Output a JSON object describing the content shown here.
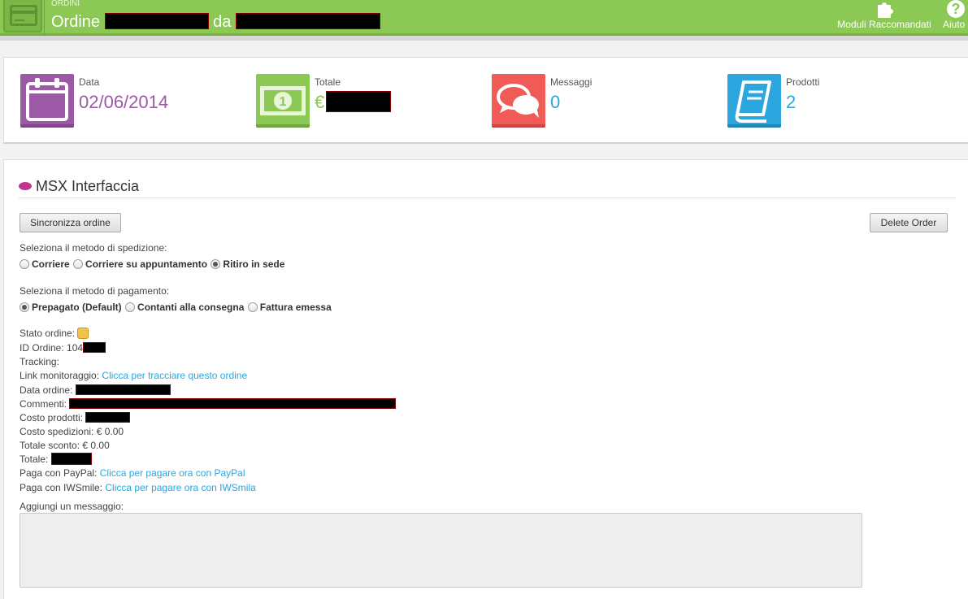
{
  "header": {
    "breadcrumb": "Ordini",
    "title_prefix": "Ordine",
    "title_connector": "da",
    "actions": [
      {
        "label": "Moduli Raccomandati",
        "icon": "puzzle-icon"
      },
      {
        "label": "Aiuto",
        "icon": "help-icon"
      }
    ],
    "colors": {
      "header_bg": "#8bc954",
      "header_border": "#76b03f"
    }
  },
  "kpis": {
    "data": {
      "label": "Data",
      "value": "02/06/2014",
      "icon": "calendar-icon",
      "color": "#9c5aa6"
    },
    "totale": {
      "label": "Totale",
      "currency": "€",
      "icon": "banknote-icon",
      "color": "#8bc954"
    },
    "messaggi": {
      "label": "Messaggi",
      "value": "0",
      "icon": "chat-bubbles-icon",
      "color": "#f05a57"
    },
    "prodotti": {
      "label": "Prodotti",
      "value": "2",
      "icon": "book-icon",
      "color": "#2ba6de"
    }
  },
  "module": {
    "title": "MSX Interfaccia",
    "sync_button": "Sincronizza ordine",
    "delete_button": "Delete Order",
    "shipping": {
      "label": "Seleziona il metodo di spedizione:",
      "options": [
        "Corriere",
        "Corriere su appuntamento",
        "Ritiro in sede"
      ],
      "selected": "Ritiro in sede"
    },
    "payment": {
      "label": "Seleziona il metodo di pagamento:",
      "options": [
        "Prepagato (Default)",
        "Contanti alla consegna",
        "Fattura emessa"
      ],
      "selected": "Prepagato (Default)"
    },
    "details": {
      "stato_label": "Stato ordine:",
      "id_label": "ID Ordine:",
      "id_prefix": "104",
      "tracking_label": "Tracking:",
      "link_label": "Link monitoraggio:",
      "link_text": "Clicca per tracciare questo ordine",
      "data_label": "Data ordine:",
      "commenti_label": "Commenti:",
      "costo_prodotti_label": "Costo prodotti:",
      "costo_spedizioni_label": "Costo spedizioni:",
      "costo_spedizioni_value": "€ 0.00",
      "sconto_label": "Totale sconto:",
      "sconto_value": "€ 0.00",
      "totale_label": "Totale:",
      "paypal_label": "Paga con PayPal:",
      "paypal_link": "Clicca per pagare ora con PayPal",
      "iwsmile_label": "Paga con IWSmile:",
      "iwsmile_link": "Clicca per pagare ora con IWSmila"
    },
    "message_label": "Aggiungi un messaggio:"
  }
}
